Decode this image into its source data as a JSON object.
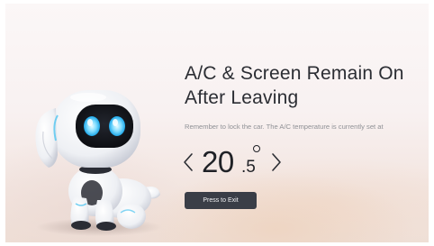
{
  "notice": {
    "title_line1": "A/C & Screen Remain On",
    "title_line2": "After Leaving",
    "subtitle": "Remember to lock the car. The A/C temperature is currently set at",
    "temperature_integer": "20",
    "temperature_decimal": ".5",
    "temperature_unit_icon": "degree-icon",
    "decrease_icon": "chevron-left-icon",
    "increase_icon": "chevron-right-icon",
    "exit_button_label": "Press to Exit"
  },
  "colors": {
    "title": "#2b2d33",
    "subtitle": "#8f9196",
    "button_bg": "#3a3e47",
    "button_text": "#f2f3f5",
    "robot_eye": "#4fc4f0"
  }
}
